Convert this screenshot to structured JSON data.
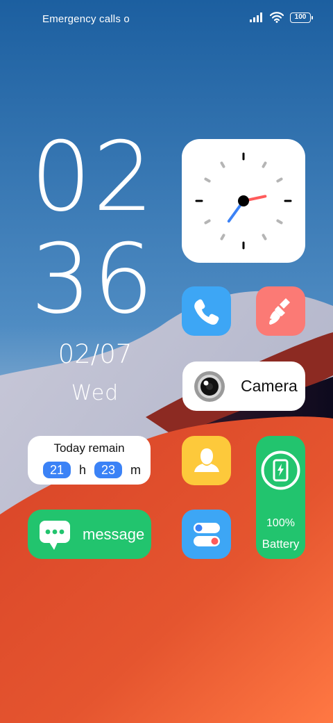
{
  "status_bar": {
    "carrier_text": "Emergency calls o",
    "signal_icon": "signal-bars-icon",
    "wifi_icon": "wifi-icon",
    "battery_level": "100"
  },
  "clock": {
    "hour": "02",
    "minute": "36",
    "date": "02/07",
    "weekday": "Wed"
  },
  "analog_clock": {
    "hour": 2,
    "minute": 36,
    "colors": {
      "hour_hand": "#ff5b5b",
      "minute_hand": "#3b82f6",
      "center": "#000000"
    }
  },
  "apps": {
    "phone": {
      "icon": "phone-icon",
      "color": "#3da6f5"
    },
    "cleaner": {
      "icon": "broom-icon",
      "color": "#fb7a75"
    },
    "contacts": {
      "icon": "contact-person-icon",
      "color": "#fdc93b"
    },
    "settings": {
      "icon": "toggle-switches-icon",
      "color": "#3da6f5"
    }
  },
  "camera_widget": {
    "label": "Camera",
    "icon": "camera-lens-icon"
  },
  "today_remain": {
    "title": "Today remain",
    "hours": "21",
    "hours_unit": "h",
    "minutes": "23",
    "minutes_unit": "m"
  },
  "message_widget": {
    "label": "message",
    "icon": "chat-bubble-icon",
    "color": "#22c46e"
  },
  "battery_widget": {
    "percent": "100%",
    "label": "Battery",
    "icon": "phone-charging-icon",
    "level": 1.0,
    "color": "#22c46e"
  }
}
